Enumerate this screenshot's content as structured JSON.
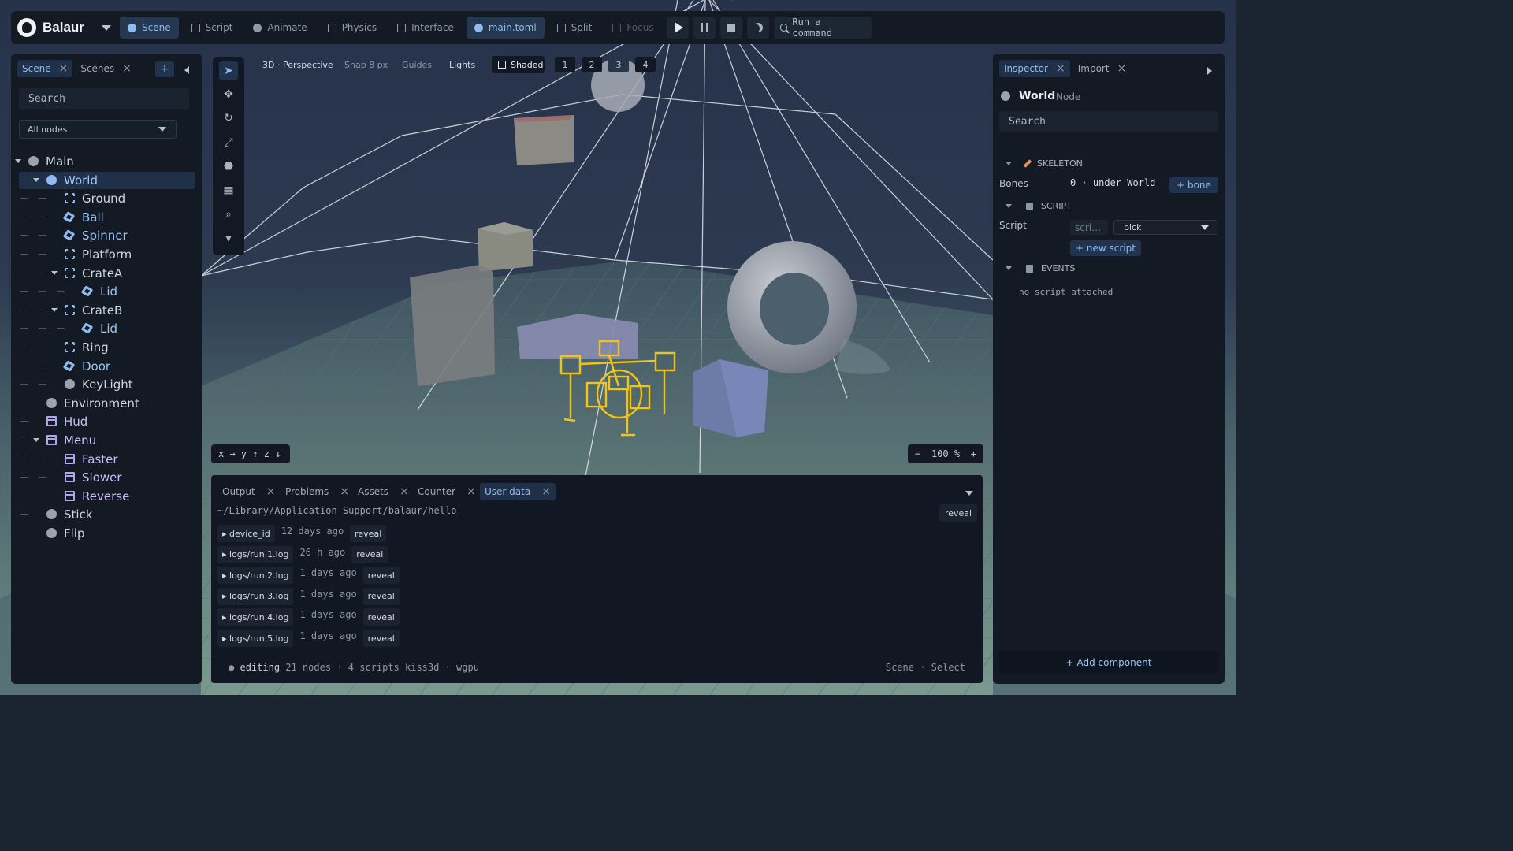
{
  "app": {
    "name": "Balaur"
  },
  "toolbar": {
    "modes": [
      {
        "label": "Scene",
        "icon": "scene-icon",
        "active": true
      },
      {
        "label": "Script",
        "icon": "script-icon",
        "active": false
      },
      {
        "label": "Animate",
        "icon": "animate-icon",
        "active": false
      },
      {
        "label": "Physics",
        "icon": "physics-icon",
        "active": false
      },
      {
        "label": "Interface",
        "icon": "interface-icon",
        "active": false
      }
    ],
    "file": "main.toml",
    "split": "Split",
    "focus": "Focus",
    "command_label": "Run a command"
  },
  "scene_panel": {
    "tabs": [
      {
        "label": "Scene",
        "close": "×"
      },
      {
        "label": "Scenes",
        "close": "×"
      }
    ],
    "add": "+",
    "search_placeholder": "Search",
    "filter": "All nodes",
    "tree": [
      {
        "label": "Main",
        "depth": 0,
        "icon": "node-dot-icon",
        "expanded": true
      },
      {
        "label": "World",
        "depth": 1,
        "icon": "node-dot-icon",
        "expanded": true,
        "selected": true
      },
      {
        "label": "Ground",
        "depth": 2,
        "icon": "mesh-icon"
      },
      {
        "label": "Ball",
        "depth": 2,
        "icon": "cube-icon"
      },
      {
        "label": "Spinner",
        "depth": 2,
        "icon": "cube-icon"
      },
      {
        "label": "Platform",
        "depth": 2,
        "icon": "mesh-icon"
      },
      {
        "label": "CrateA",
        "depth": 2,
        "icon": "mesh-icon",
        "expanded": true
      },
      {
        "label": "Lid",
        "depth": 3,
        "icon": "cube-icon"
      },
      {
        "label": "CrateB",
        "depth": 2,
        "icon": "mesh-icon",
        "expanded": true
      },
      {
        "label": "Lid",
        "depth": 3,
        "icon": "cube-icon"
      },
      {
        "label": "Ring",
        "depth": 2,
        "icon": "mesh-icon"
      },
      {
        "label": "Door",
        "depth": 2,
        "icon": "cube-icon"
      },
      {
        "label": "KeyLight",
        "depth": 2,
        "icon": "node-dot-icon"
      },
      {
        "label": "Environment",
        "depth": 1,
        "icon": "node-dot-icon"
      },
      {
        "label": "Hud",
        "depth": 1,
        "icon": "ui-icon"
      },
      {
        "label": "Menu",
        "depth": 1,
        "icon": "ui-icon",
        "expanded": true
      },
      {
        "label": "Faster",
        "depth": 2,
        "icon": "ui-icon"
      },
      {
        "label": "Slower",
        "depth": 2,
        "icon": "ui-icon"
      },
      {
        "label": "Reverse",
        "depth": 2,
        "icon": "ui-icon"
      },
      {
        "label": "Stick",
        "depth": 1,
        "icon": "node-dot-icon"
      },
      {
        "label": "Flip",
        "depth": 1,
        "icon": "node-dot-icon"
      }
    ]
  },
  "viewport": {
    "view": "3D · Perspective",
    "snap": "Snap 8 px",
    "guides": "Guides",
    "lights": "Lights",
    "shading": "Shaded",
    "layouts": [
      "1",
      "2",
      "3",
      "4"
    ],
    "selected_layout": "3",
    "axes": "x → y ↑ z ↓",
    "zoom_minus": "−",
    "zoom": "100 %",
    "zoom_plus": "+"
  },
  "bottom_panel": {
    "tabs": [
      {
        "label": "Output",
        "close": "×"
      },
      {
        "label": "Problems",
        "close": "×"
      },
      {
        "label": "Assets",
        "close": "×"
      },
      {
        "label": "Counter",
        "close": "×"
      },
      {
        "label": "User data",
        "close": "×"
      }
    ],
    "path": "~/Library/Application Support/balaur/hello",
    "reveal_label": "reveal",
    "files": [
      {
        "name": "▸ device_id",
        "age": "12 days ago",
        "action": "reveal"
      },
      {
        "name": "▸ logs/run.1.log",
        "age": "26 h ago",
        "action": "reveal"
      },
      {
        "name": "▸ logs/run.2.log",
        "age": "1 days ago",
        "action": "reveal"
      },
      {
        "name": "▸ logs/run.3.log",
        "age": "1 days ago",
        "action": "reveal"
      },
      {
        "name": "▸ logs/run.4.log",
        "age": "1 days ago",
        "action": "reveal"
      },
      {
        "name": "▸ logs/run.5.log",
        "age": "1 days ago",
        "action": "reveal"
      }
    ],
    "status_dot": "●",
    "status_mode": "editing",
    "status_details": "21 nodes · 4 scripts kiss3d · wgpu",
    "status_right": "Scene · Select"
  },
  "inspector": {
    "tabs": [
      {
        "label": "Inspector",
        "close": "×"
      },
      {
        "label": "Import",
        "close": "×"
      }
    ],
    "node_name": "World",
    "node_type": "Node",
    "search_placeholder": "Search",
    "skeleton": {
      "title": "SKELETON",
      "bones_label": "Bones",
      "bones_value": "0 · under World",
      "add_bone": "+ bone"
    },
    "script": {
      "title": "SCRIPT",
      "label": "Script",
      "field_placeholder": "scri…",
      "pick": "pick",
      "new_script": "+ new script"
    },
    "events": {
      "title": "EVENTS",
      "empty": "no script attached"
    },
    "add_component": "+ Add component"
  },
  "colors": {
    "accent": "#8fbcf0",
    "selection": "#f0c419",
    "panel": "#131a24"
  }
}
